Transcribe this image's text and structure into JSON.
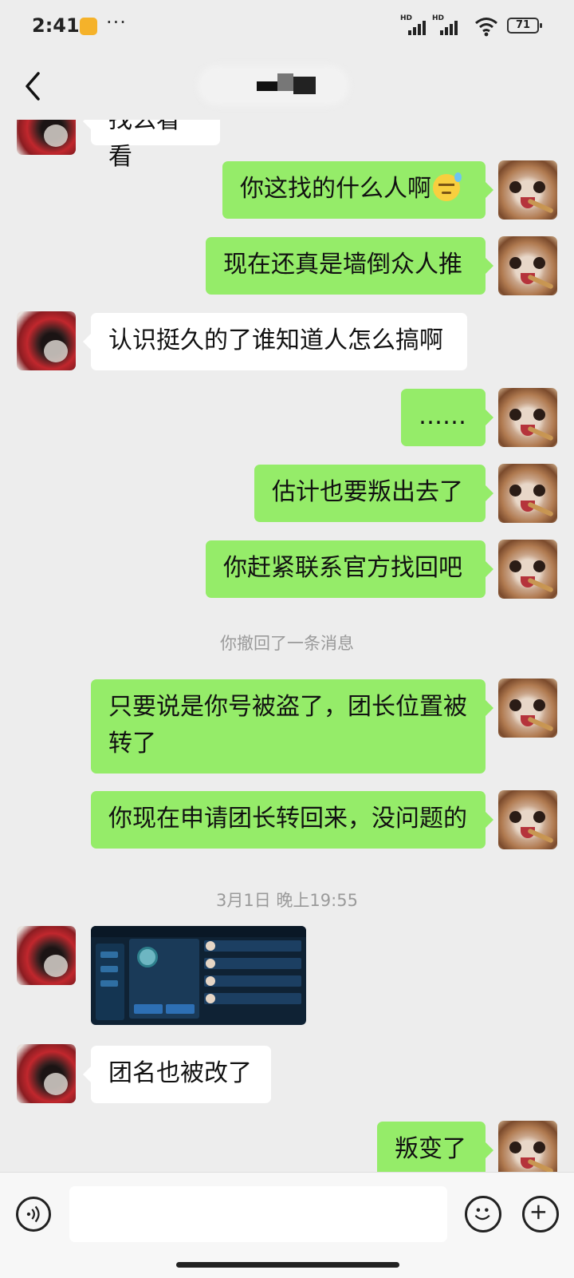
{
  "status_bar": {
    "time": "2:41",
    "more": "···",
    "signal1_label": "HD",
    "signal2_label": "HD",
    "battery": "71"
  },
  "nav": {
    "back_icon": "chevron-left-icon",
    "title": ""
  },
  "messages": [
    {
      "side": "left",
      "text": "找么看看"
    },
    {
      "side": "right",
      "text": "你这找的什么人啊",
      "emoji": "sweat-smile-emoji"
    },
    {
      "side": "right",
      "text": "现在还真是墙倒众人推"
    },
    {
      "side": "left",
      "text": "认识挺久的了谁知道人怎么搞啊"
    },
    {
      "side": "right",
      "text": "……"
    },
    {
      "side": "right",
      "text": "估计也要叛出去了"
    },
    {
      "side": "right",
      "text": "你赶紧联系官方找回吧"
    },
    {
      "type": "system",
      "text": "你撤回了一条消息"
    },
    {
      "side": "right",
      "text": "只要说是你号被盗了，团长位置被转了"
    },
    {
      "side": "right",
      "text": "你现在申请团长转回来，没问题的"
    },
    {
      "type": "timestamp",
      "text": "3月1日 晚上19:55"
    },
    {
      "side": "left",
      "type": "image",
      "description": "game-screenshot"
    },
    {
      "side": "left",
      "text": "团名也被改了"
    },
    {
      "side": "right",
      "text": "叛变了"
    }
  ],
  "input_bar": {
    "voice_icon": "voice-icon",
    "input_placeholder": "",
    "emoji_icon": "emoji-icon",
    "plus_icon": "plus-icon"
  },
  "colors": {
    "background": "#ededed",
    "my_bubble": "#95ec69",
    "their_bubble": "#ffffff",
    "system_text": "#9a9a9a"
  }
}
